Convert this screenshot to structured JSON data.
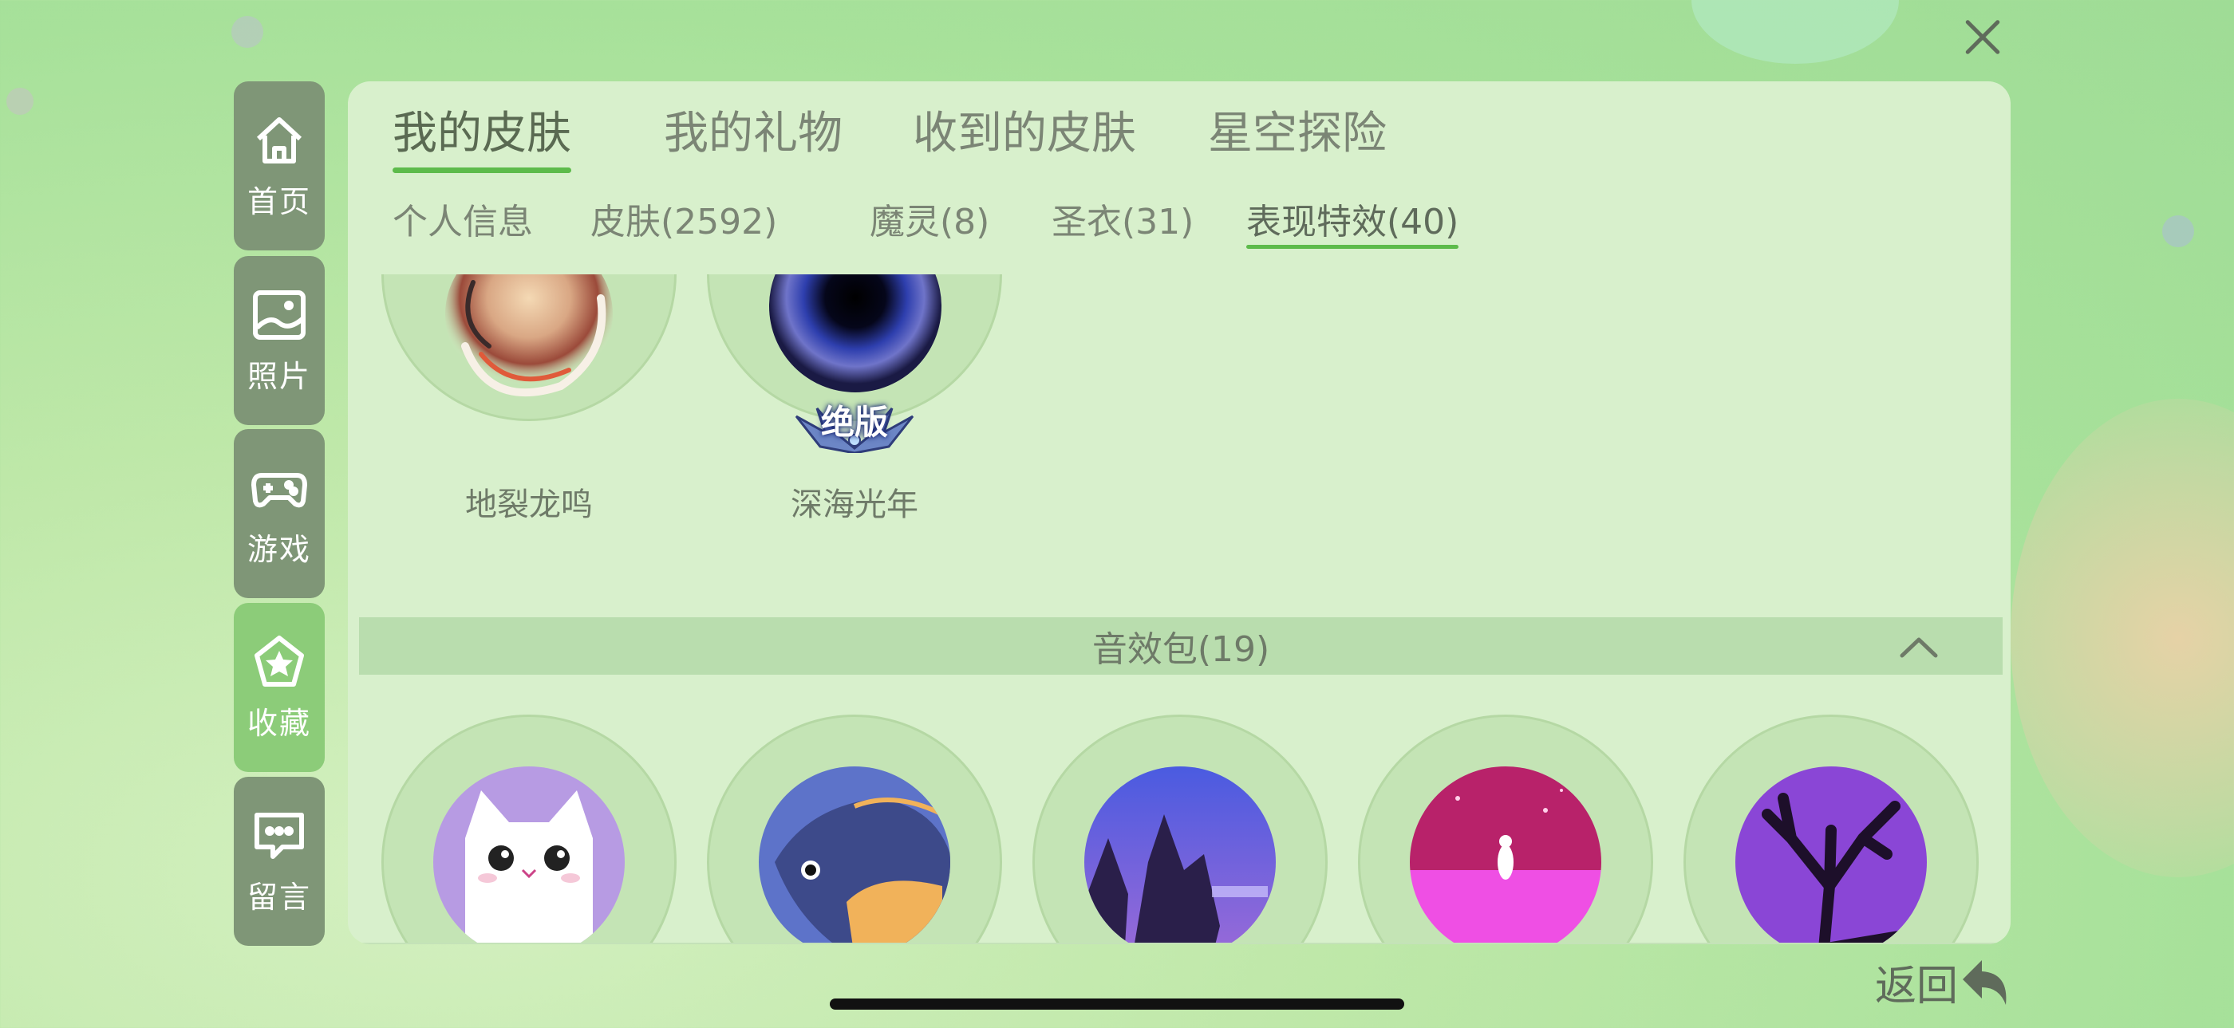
{
  "colors": {
    "accent": "#5dbb4b",
    "sidebar_bg": "#7f9677",
    "sidebar_active": "#8ccc79",
    "panel_bg": "#d8f0cc"
  },
  "sidebar": {
    "items": [
      {
        "label": "首页",
        "icon": "home-icon"
      },
      {
        "label": "照片",
        "icon": "photo-icon"
      },
      {
        "label": "游戏",
        "icon": "gamepad-icon"
      },
      {
        "label": "收藏",
        "icon": "star-badge-icon",
        "active": true
      },
      {
        "label": "留言",
        "icon": "message-icon"
      }
    ]
  },
  "tabs": [
    {
      "label": "我的皮肤",
      "active": true
    },
    {
      "label": "我的礼物"
    },
    {
      "label": "收到的皮肤"
    },
    {
      "label": "星空探险"
    }
  ],
  "subtabs": [
    {
      "label": "个人信息"
    },
    {
      "label": "皮肤(2592)"
    },
    {
      "label": "魔灵(8)"
    },
    {
      "label": "圣衣(31)"
    },
    {
      "label": "表现特效(40)",
      "active": true
    }
  ],
  "effects": [
    {
      "label": "地裂龙鸣"
    },
    {
      "label": "深海光年",
      "badge": "绝版"
    }
  ],
  "sound_section": {
    "title": "音效包(19)",
    "icon": "chevron-up-icon"
  },
  "sound_items": [
    "cat",
    "fish",
    "forest-night",
    "pink-sea-girl",
    "purple-tree"
  ],
  "close_icon": "close-icon",
  "back": {
    "label": "返回",
    "icon": "return-arrow-icon"
  }
}
